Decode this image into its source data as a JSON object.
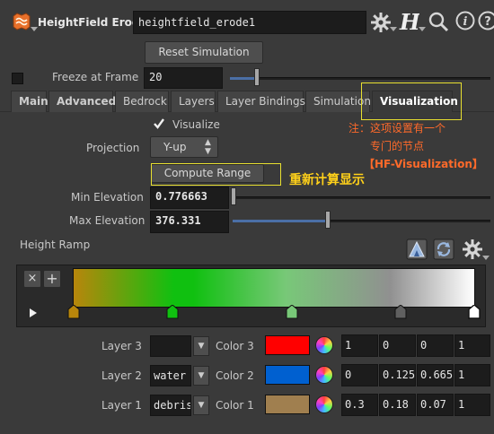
{
  "header": {
    "node_type": "HeightField Erode",
    "node_name": "heightfield_erode1",
    "icons": [
      "gear-icon",
      "houdini-h-icon",
      "search-icon",
      "info-icon",
      "help-icon"
    ]
  },
  "reset_button": "Reset Simulation",
  "freeze": {
    "label": "Freeze at Frame",
    "value": "20",
    "checked": false
  },
  "tabs": [
    {
      "label": "Main",
      "active": false
    },
    {
      "label": "Advanced",
      "active": false
    },
    {
      "label": "Bedrock",
      "active": false
    },
    {
      "label": "Layers",
      "active": false
    },
    {
      "label": "Layer Bindings",
      "active": false
    },
    {
      "label": "Simulation",
      "active": false
    },
    {
      "label": "Visualization",
      "active": true
    }
  ],
  "visualize": {
    "label": "Visualize",
    "checked": true
  },
  "projection": {
    "label": "Projection",
    "value": "Y-up"
  },
  "compute_range": "Compute Range",
  "min_elevation": {
    "label": "Min Elevation",
    "value": "0.776663",
    "slider": 0.0
  },
  "max_elevation": {
    "label": "Max Elevation",
    "value": "376.331",
    "slider": 0.4
  },
  "height_ramp": {
    "label": "Height Ramp"
  },
  "annotations": {
    "note1": "注：这项设置有一个",
    "note2": "专门的节点",
    "note3": "【HF-Visualization】",
    "compute_note": "重新计算显示"
  },
  "layers": [
    {
      "layer_label": "Layer 3",
      "layer_value": "",
      "color_label": "Color 3",
      "color": "#ff0000",
      "rgb": [
        "1",
        "0",
        "0"
      ],
      "alpha": "1"
    },
    {
      "layer_label": "Layer 2",
      "layer_value": "water",
      "color_label": "Color 2",
      "color": "#0060d0",
      "rgb": [
        "0",
        "0.125",
        "0.665"
      ],
      "alpha": "1"
    },
    {
      "layer_label": "Layer 1",
      "layer_value": "debris",
      "color_label": "Color 1",
      "color": "#a07f4f",
      "rgb": [
        "0.3",
        "0.18",
        "0.07"
      ],
      "alpha": "1"
    }
  ],
  "ramp_colors": {
    "stop1": "#b8860b",
    "stop2": "#10c010",
    "stop3": "#78c878",
    "stop4": "#606060",
    "stop5": "#ffffff"
  },
  "colors": {
    "annotation_border": "#e8e030",
    "annotation_text": "#ff6a2a",
    "compute_note_text": "#ffd11a",
    "slider_fill": "#4b6fa6"
  }
}
